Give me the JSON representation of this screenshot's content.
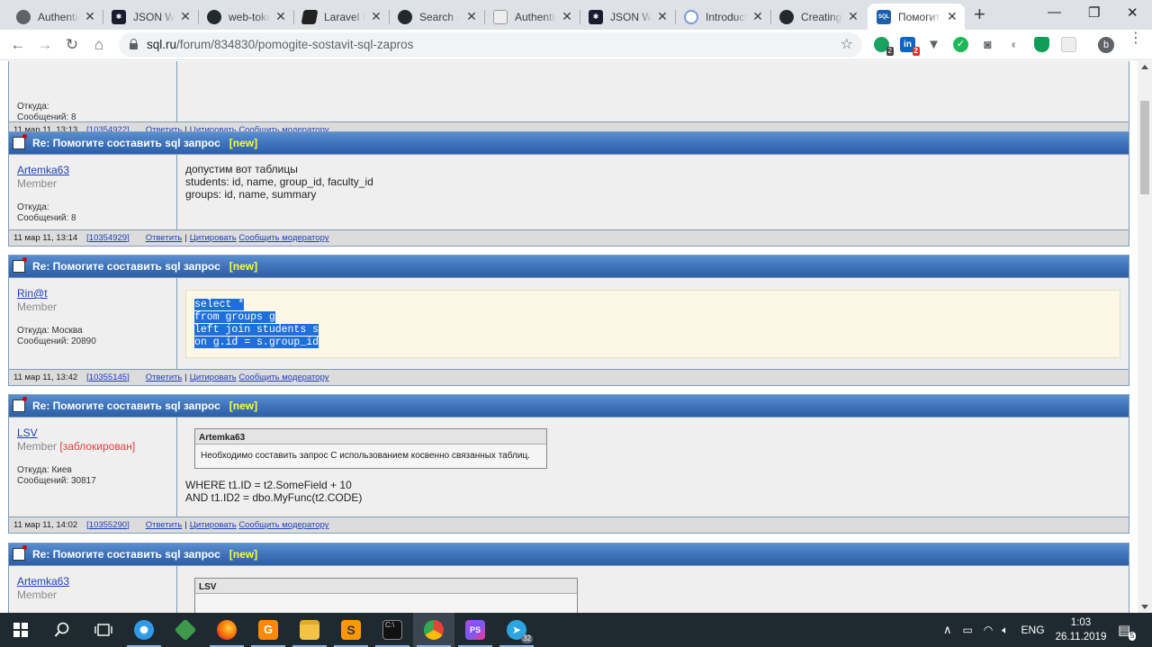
{
  "browser": {
    "tabs": [
      {
        "title": "Authentic",
        "icon": "auth0-icon",
        "active": false
      },
      {
        "title": "JSON We",
        "icon": "jwt-icon",
        "active": false
      },
      {
        "title": "web-toke",
        "icon": "github-icon",
        "active": false
      },
      {
        "title": "Laravel In",
        "icon": "laravel-icon",
        "active": false
      },
      {
        "title": "Search · t",
        "icon": "github-icon",
        "active": false
      },
      {
        "title": "Authentic",
        "icon": "auth0-icon",
        "active": false
      },
      {
        "title": "JSON We",
        "icon": "jwt-icon",
        "active": false
      },
      {
        "title": "Introduct",
        "icon": "intro-icon",
        "active": false
      },
      {
        "title": "Creating",
        "icon": "github-icon",
        "active": false
      },
      {
        "title": "Помогит",
        "icon": "sqlru-icon",
        "active": true
      }
    ],
    "close_glyph": "✕",
    "new_tab_glyph": "+",
    "url_host": "sql.ru",
    "url_path": "/forum/834830/pomogite-sostavit-sql-zapros",
    "ext_badges": {
      "ext1": "2",
      "linkedin": "2"
    },
    "avatar_letter": "b"
  },
  "posts": [
    {
      "author": "",
      "role": "",
      "from": "Откуда:",
      "count": "Сообщений: 8",
      "date": "11 мар 11, 13:13",
      "id": "10354922"
    },
    {
      "title": "Re: Помогите составить sql запрос",
      "new": "[new]",
      "author": "Artemka63",
      "role": "Member",
      "from": "Откуда:",
      "count": "Сообщений: 8",
      "lines": [
        "допустим вот таблицы",
        "students: id, name, group_id, faculty_id",
        "groups: id, name, summary"
      ],
      "date": "11 мар 11, 13:14",
      "id": "10354929"
    },
    {
      "title": "Re: Помогите составить sql запрос",
      "new": "[new]",
      "author": "Rin@t",
      "role": "Member",
      "from": "Откуда: Москва",
      "count": "Сообщений: 20890",
      "code": [
        "select *",
        "from groups g",
        "left join students s",
        "on g.id = s.group_id"
      ],
      "date": "11 мар 11, 13:42",
      "id": "10355145"
    },
    {
      "title": "Re: Помогите составить sql запрос",
      "new": "[new]",
      "author": "LSV",
      "role": "Member",
      "banned": "[заблокирован]",
      "from": "Откуда: Киев",
      "count": "Сообщений: 30817",
      "quote_author": "Artemka63",
      "quote_text": "Необходимо составить запрос С использованием косвенно связанных таблиц.",
      "lines": [
        "WHERE t1.ID = t2.SomeField + 10",
        "AND t1.ID2 = dbo.MyFunc(t2.CODE)"
      ],
      "date": "11 мар 11, 14:02",
      "id": "10355290"
    },
    {
      "title": "Re: Помогите составить sql запрос",
      "new": "[new]",
      "author": "Artemka63",
      "role": "Member",
      "quote_author": "LSV"
    }
  ],
  "footer_actions": {
    "reply": "Ответить",
    "quote": "Цитировать",
    "report": "Сообщить модератору"
  },
  "taskbar": {
    "lang": "ENG",
    "time": "1:03",
    "date": "26.11.2019",
    "telegram_badge": "32",
    "notifications": "5"
  }
}
